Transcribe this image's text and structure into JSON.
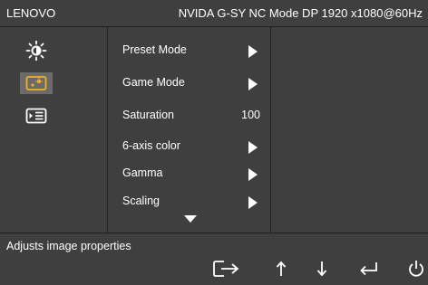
{
  "header": {
    "brand": "LENOVO",
    "status": "NVIDA G-SY NC Mode DP 1920 x1080@60Hz"
  },
  "sidebar": {
    "icons": [
      {
        "name": "brightness-icon"
      },
      {
        "name": "image-settings-icon",
        "selected": true
      },
      {
        "name": "input-source-icon"
      }
    ]
  },
  "menu": {
    "items": [
      {
        "label": "Preset Mode",
        "value": ""
      },
      {
        "label": "Game Mode",
        "value": ""
      },
      {
        "label": "Saturation",
        "value": "100"
      },
      {
        "label": "6-axis color",
        "value": ""
      },
      {
        "label": "Gamma",
        "value": ""
      },
      {
        "label": "Scaling",
        "value": ""
      }
    ]
  },
  "footer": {
    "help_text": "Adjusts image properties",
    "keys": [
      "exit-icon",
      "up-arrow-icon",
      "down-arrow-icon",
      "enter-icon",
      "power-icon"
    ]
  },
  "colors": {
    "panel": "#3f3f3f",
    "background": "#2f2f2f",
    "accent": "#f2b01e",
    "text": "#ffffff"
  }
}
